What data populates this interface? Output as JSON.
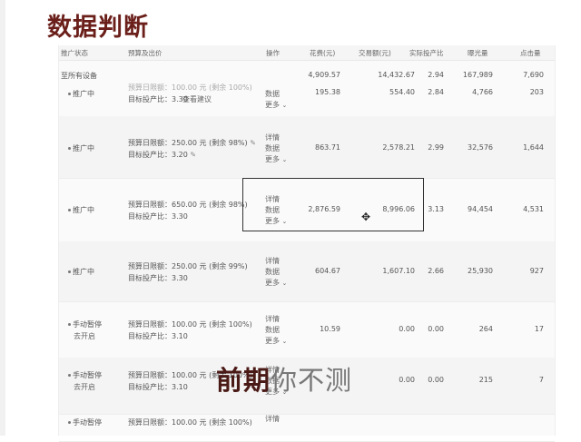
{
  "title": "数据判断",
  "subtitle": {
    "main": "前期",
    "faded": "你不测"
  },
  "table": {
    "headers": [
      "推广状态",
      "预算及出价",
      "操作",
      "花费(元)",
      "交易额(元)",
      "实际投产比",
      "曝光量",
      "点击量"
    ],
    "summary": {
      "label": "至所有设备",
      "spend": "4,909.57",
      "gmv": "14,432.67",
      "roi": "2.94",
      "impressions": "167,989",
      "clicks": "7,690"
    },
    "rows": [
      {
        "status": "推广中",
        "budget_line": "",
        "target_line": "目标投产比：3.30",
        "extra": "查看建议",
        "ops": [
          "数据",
          "更多"
        ],
        "spend": "195.38",
        "gmv": "554.40",
        "roi": "2.84",
        "impressions": "4,766",
        "clicks": "203"
      },
      {
        "status": "推广中",
        "budget_line": "预算日限额：250.00 元 (剩余 98%)",
        "target_line": "目标投产比：3.20",
        "extra": "",
        "ops": [
          "详情",
          "数据",
          "更多"
        ],
        "spend": "863.71",
        "gmv": "2,578.21",
        "roi": "2.99",
        "impressions": "32,576",
        "clicks": "1,644"
      },
      {
        "status": "推广中",
        "budget_line": "预算日限额：650.00 元 (剩余 98%)",
        "target_line": "目标投产比：3.30",
        "extra": "",
        "ops": [
          "详情",
          "数据",
          "更多"
        ],
        "spend": "2,876.59",
        "gmv": "8,996.06",
        "roi": "3.13",
        "impressions": "94,454",
        "clicks": "4,531"
      },
      {
        "status": "推广中",
        "budget_line": "预算日限额：250.00 元 (剩余 99%)",
        "target_line": "目标投产比：3.30",
        "extra": "",
        "ops": [
          "详情",
          "数据",
          "更多"
        ],
        "spend": "604.67",
        "gmv": "1,607.10",
        "roi": "2.66",
        "impressions": "25,930",
        "clicks": "927"
      },
      {
        "status": "手动暂停",
        "status2": "去开启",
        "budget_line": "预算日限额：100.00 元 (剩余 100%)",
        "target_line": "目标投产比：3.10",
        "extra": "",
        "ops": [
          "详情",
          "数据",
          "更多"
        ],
        "spend": "10.59",
        "gmv": "0.00",
        "roi": "0.00",
        "impressions": "264",
        "clicks": "17"
      },
      {
        "status": "手动暂停",
        "status2": "去开启",
        "budget_line": "预算日限额：100.00 元 (剩余 100%)",
        "target_line": "目标投产比：3.10",
        "extra": "",
        "ops": [
          "详情",
          "数据",
          "更多"
        ],
        "spend": "",
        "gmv": "0.00",
        "roi": "0.00",
        "impressions": "215",
        "clicks": "7"
      },
      {
        "status": "手动暂停",
        "status2": "",
        "budget_line": "预算日限额：100.00 元 (剩余 100%)",
        "target_line": "",
        "extra": "",
        "ops": [
          "详情"
        ],
        "spend": "",
        "gmv": "",
        "roi": "",
        "impressions": "",
        "clicks": ""
      }
    ],
    "partial_top_line": "预算日限额：100.00 元 (剩余 100%)"
  }
}
